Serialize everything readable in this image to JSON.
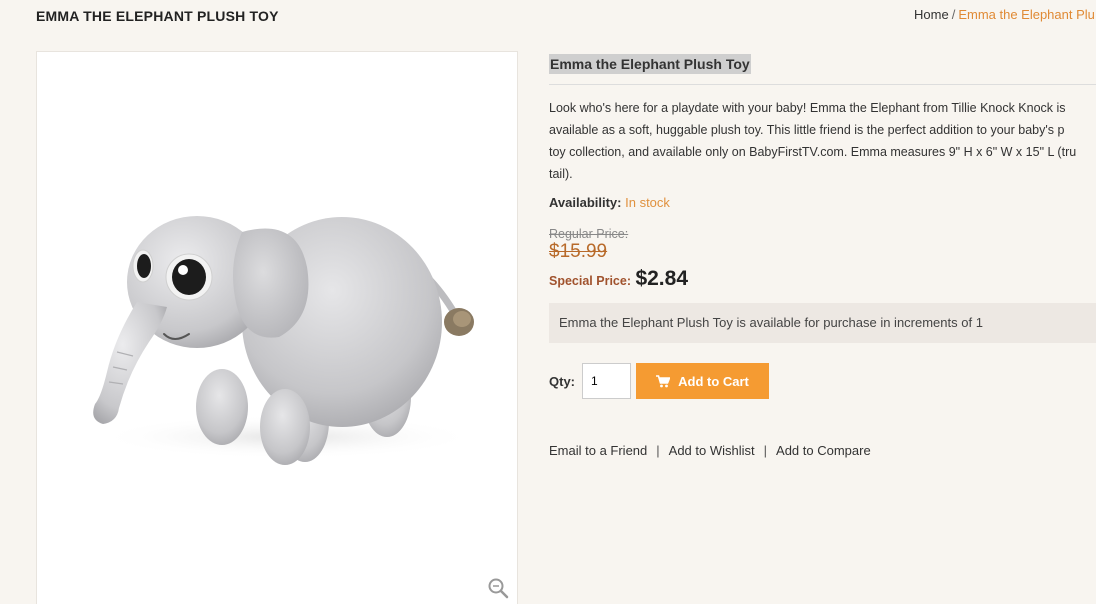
{
  "page": {
    "title": "EMMA THE ELEPHANT PLUSH TOY"
  },
  "breadcrumb": {
    "home": "Home",
    "separator": "/",
    "current": "Emma the Elephant Plu"
  },
  "product": {
    "name": "Emma the Elephant Plush Toy",
    "description_lines": [
      "Look who's here for a playdate with your baby! Emma the Elephant from Tillie Knock Knock is",
      "available as a soft, huggable plush toy. This little friend is the perfect addition to your baby's p",
      "toy collection, and available only on BabyFirstTV.com. Emma measures 9\" H x 6\" W x 15\" L (tru",
      "tail)."
    ],
    "availability_label": "Availability:",
    "availability_value": "In stock",
    "regular_price_label": "Regular Price:",
    "regular_price": "$15.99",
    "special_price_label": "Special Price:",
    "special_price": "$2.84",
    "increment_notice": "Emma the Elephant Plush Toy is available for purchase in increments of 1",
    "image_icon": "zoom-icon"
  },
  "cart": {
    "qty_label": "Qty:",
    "qty_value": "1",
    "add_to_cart_label": "Add to Cart",
    "button_icon": "cart-icon"
  },
  "links": {
    "email_friend": "Email to a Friend",
    "separator": "|",
    "add_wishlist": "Add to Wishlist",
    "add_compare": "Add to Compare"
  },
  "colors": {
    "accent": "#f59b32",
    "in_stock": "#e0913e",
    "special_label": "#a0522d",
    "regular_price": "#b86a2a",
    "background": "#f8f5f0",
    "notice_bg": "#ede8e3"
  }
}
